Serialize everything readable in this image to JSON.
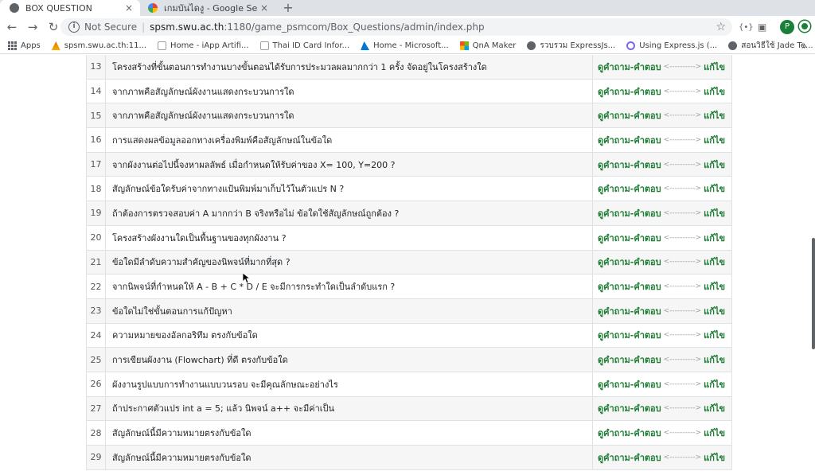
{
  "tabs": [
    {
      "title": "BOX QUESTION",
      "close": "×"
    },
    {
      "title": "เกมบันไดงู - Google Search",
      "close": "×"
    }
  ],
  "new_tab": "+",
  "nav": {
    "back": "←",
    "forward": "→",
    "reload": "↻"
  },
  "address": {
    "security_label": "Not Secure",
    "separator": "|",
    "host": "spsm.swu.ac.th",
    "path": ":1180/game_psmcom/Box_Questions/admin/index.php",
    "info_glyph": "i",
    "star": "☆"
  },
  "toolbar_right": {
    "ext1": "{•}",
    "ext2": "▣",
    "avatar": "P"
  },
  "bookmarks": [
    {
      "label": "Apps"
    },
    {
      "label": "spsm.swu.ac.th:11..."
    },
    {
      "label": "Home - iApp Artifi..."
    },
    {
      "label": "Thai ID Card Infor..."
    },
    {
      "label": "Home - Microsoft..."
    },
    {
      "label": "QnA Maker"
    },
    {
      "label": "รวบรวม ExpressJs..."
    },
    {
      "label": "Using Express.js (..."
    },
    {
      "label": "สอนวิธีใช้ Jade Te..."
    }
  ],
  "bookmarks_more": "»",
  "colors": {
    "link_green": "#1e7e34",
    "tab_strip": "#dee1e6",
    "omnibox": "#f1f3f4"
  },
  "table": {
    "view_label": "ดูคำถาม-คำตอบ",
    "arrow": "<---------->",
    "edit_label": "แก้ไข",
    "rows": [
      {
        "num": "13",
        "question": "โครงสร้างที่ขั้นตอนการทำงานบางขั้นตอนได้รับการประมวลผลมากกว่า 1 ครั้ง จัดอยู่ในโครงสร้างใด"
      },
      {
        "num": "14",
        "question": "จากภาพคือสัญลักษณ์ผังงานแสดงกระบวนการใด"
      },
      {
        "num": "15",
        "question": "จากภาพคือสัญลักษณ์ผังงานแสดงกระบวนการใด"
      },
      {
        "num": "16",
        "question": "การแสดงผลข้อมูลออกทางเครื่องพิมพ์คือสัญลักษณ์ในข้อใด"
      },
      {
        "num": "17",
        "question": "จากผังงานต่อไปนี้จงหาผลลัพธ์ เมื่อกำหนดให้รับค่าของ X= 100, Y=200 ?"
      },
      {
        "num": "18",
        "question": "สัญลักษณ์ข้อใดรับค่าจากทางแป้นพิมพ์มาเก็บไว้ในตัวแปร N ?"
      },
      {
        "num": "19",
        "question": "ถ้าต้องการตรวจสอบค่า A มากกว่า B จริงหรือไม่ ข้อใดใช้สัญลักษณ์ถูกต้อง ?"
      },
      {
        "num": "20",
        "question": "โครงสร้างผังงานใดเป็นพื้นฐานของทุกผังงาน ?"
      },
      {
        "num": "21",
        "question": "ข้อใดมีลำดับความสำคัญของนิพจน์ที่มากที่สุด ?"
      },
      {
        "num": "22",
        "question": "จากนิพจน์ที่กำหนดให้ A - B + C * D / E จะมีการกระทำใดเป็นลำดับแรก ?"
      },
      {
        "num": "23",
        "question": "ข้อใดไม่ใช่ขั้นตอนการแก้ปัญหา"
      },
      {
        "num": "24",
        "question": "ความหมายของอัลกอริทึม ตรงกับข้อใด"
      },
      {
        "num": "25",
        "question": "การเขียนผังงาน (Flowchart) ที่ดี ตรงกับข้อใด"
      },
      {
        "num": "26",
        "question": "ผังงานรูปแบบการทำงานแบบวนรอบ จะมีคุณลักษณะอย่างไร"
      },
      {
        "num": "27",
        "question": "ถ้าประกาศตัวแปร int a = 5; แล้ว นิพจน์ a++ จะมีค่าเป็น"
      },
      {
        "num": "28",
        "question": "สัญลักษณ์นี้มีความหมายตรงกับข้อใด"
      },
      {
        "num": "29",
        "question": "สัญลักษณ์นี้มีความหมายตรงกับข้อใด"
      }
    ]
  }
}
